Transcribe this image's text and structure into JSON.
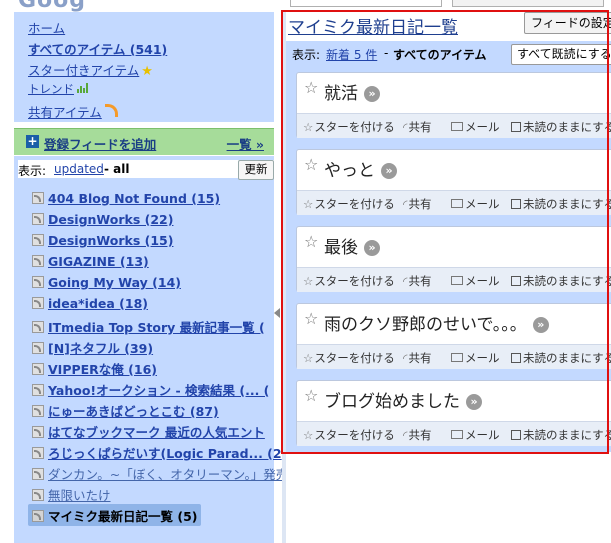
{
  "top": {
    "logo_fragment": "Goog"
  },
  "nav": {
    "home": "ホーム",
    "all_items": "すべてのアイテム (541)",
    "starred": "スター付きアイテム",
    "trends": "トレンド",
    "shared": "共有アイテム"
  },
  "add_feed": {
    "label": "登録フィードを追加",
    "list": "一覧 »"
  },
  "feeds_view": {
    "label": "表示:",
    "updated": "updated",
    "separator_all": "- all",
    "refresh": "更新"
  },
  "feeds": [
    "404 Blog Not Found (15)",
    "DesignWorks (22)",
    "DesignWorks (15)",
    "GIGAZINE (13)",
    "Going My Way (14)",
    "idea*idea (18)",
    "ITmedia Top Story 最新記事一覧 (",
    "[N]ネタフル (39)",
    "VIPPERな俺 (16)",
    "Yahoo!オークション - 検索結果 (... (",
    "にゅーあきばどっとこむ (87)",
    "はてなブックマーク 最近の人気エント",
    "ろじっくぱらだいす(Logic Parad... (2",
    "ダンカン。~「ぼく、オタリーマン。」発売",
    "無限いたけ",
    "マイミク最新日記一覧 (5)"
  ],
  "main": {
    "title": "マイミク最新日記一覧",
    "feed_settings": "フィードの設定",
    "view_label": "表示:",
    "new_count": "新着 5 件",
    "dash": "-",
    "all_items": "すべてのアイテム",
    "mark_all_read": "すべて既読にする"
  },
  "entry_actions": {
    "star": "スターを付ける",
    "share": "共有",
    "mail": "メール",
    "keep_unread": "未読のままにする"
  },
  "entries": [
    {
      "title": "就活"
    },
    {
      "title": "やっと"
    },
    {
      "title": "最後"
    },
    {
      "title": "雨のクソ野郎のせいで。。。"
    },
    {
      "title": "ブログ始めました"
    }
  ],
  "colors": {
    "highlight_frame": "#e01010",
    "panel_blue": "#c3d9ff",
    "add_feed_green": "#a6dc9a"
  }
}
